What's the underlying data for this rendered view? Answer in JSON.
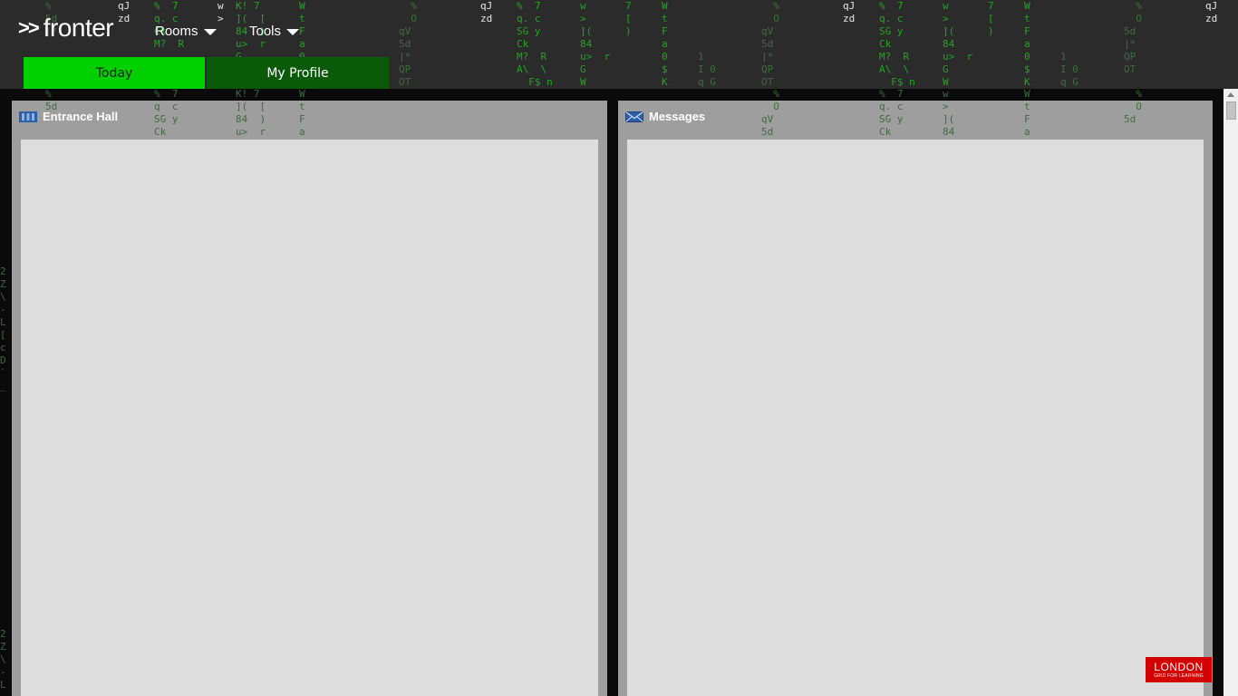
{
  "app": {
    "logo_text": "fronter",
    "logo_prefix": ">>"
  },
  "nav": {
    "rooms_label": "Rooms",
    "tools_label": "Tools"
  },
  "tabs": {
    "today": "Today",
    "my_profile": "My Profile"
  },
  "panels": {
    "left_title": "Entrance Hall",
    "left_icon": "hall-icon",
    "right_title": "Messages",
    "right_icon": "envelope-icon"
  },
  "badge": {
    "line1": "LONDON",
    "line2": "GRID FOR LEARNING"
  },
  "colors": {
    "topbar": "#2b2b2b",
    "tab_active": "#00d000",
    "tab_inactive": "#0a5a0a",
    "panel_frame": "#9e9e9e",
    "panel_body": "#dddddd",
    "badge": "#d40000"
  }
}
